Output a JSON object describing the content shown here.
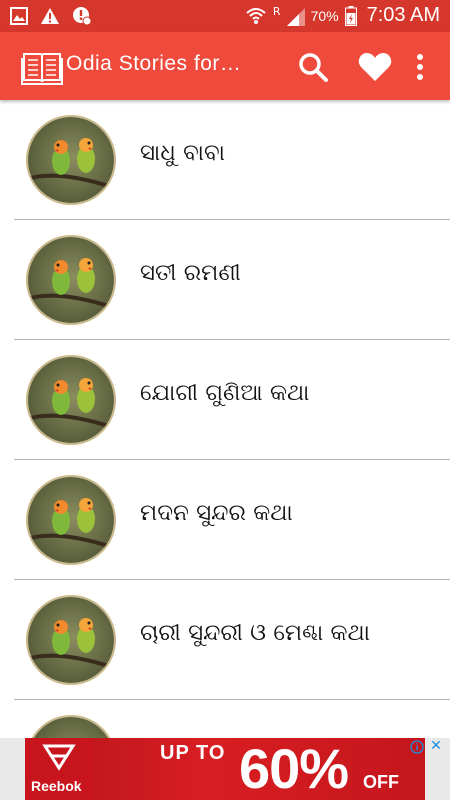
{
  "status_bar": {
    "battery_pct": "70%",
    "time": "7:03 AM",
    "network_label": "R",
    "icons": [
      "image-icon",
      "warning-icon",
      "blocked-icon",
      "wifi-icon",
      "signal-icon",
      "battery-icon"
    ]
  },
  "app_bar": {
    "title": "Odia Stories for…",
    "icons": [
      "book-icon",
      "search-icon",
      "heart-icon",
      "more-vert-icon"
    ]
  },
  "stories": [
    {
      "title": "ସାଧୁ ବାବା"
    },
    {
      "title": "ସତୀ ରମଣୀ"
    },
    {
      "title": "ଯୋଗୀ ଗୁଣିଆ କଥା"
    },
    {
      "title": "ମଦନ ସୁନ୍ଦର କଥା"
    },
    {
      "title": "ଚାରୀ ସୁନ୍ଦରୀ ଓ ମେଣ୍ଢା କଥା"
    },
    {
      "title": ""
    }
  ],
  "ad": {
    "brand": "Reebok",
    "up_to": "UP TO",
    "percent": "60%",
    "off": "OFF",
    "close_label": "✕"
  },
  "colors": {
    "status_bar": "#d6372c",
    "app_bar": "#f04a3c",
    "divider": "#b7b7b7"
  }
}
